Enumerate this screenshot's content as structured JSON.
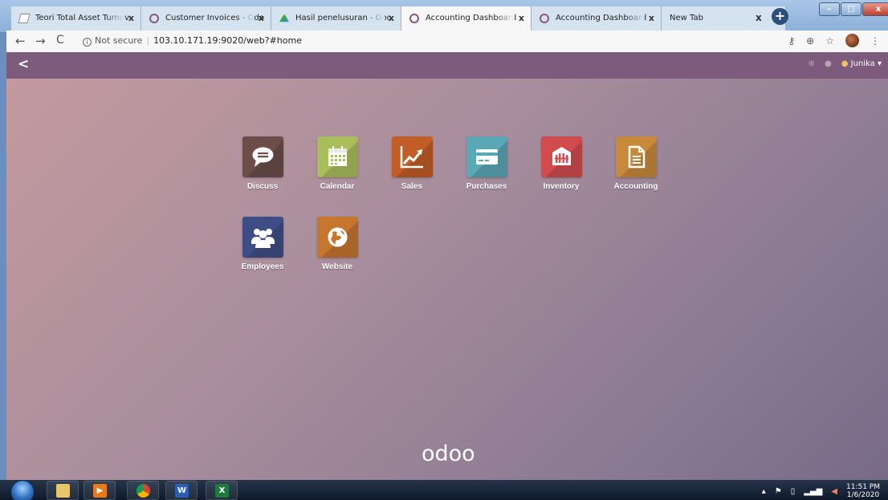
{
  "browser": {
    "tabs": [
      {
        "title": "Teori Total Asset Turnov",
        "favicon": "document-icon",
        "active": false
      },
      {
        "title": "Customer Invoices - Odo",
        "favicon": "odoo-icon",
        "active": false
      },
      {
        "title": "Hasil penelusuran - Goo",
        "favicon": "google-drive-icon",
        "active": false
      },
      {
        "title": "Accounting Dashboard",
        "favicon": "odoo-icon",
        "active": true
      },
      {
        "title": "Accounting Dashboard",
        "favicon": "odoo-icon",
        "active": false
      },
      {
        "title": "New Tab",
        "favicon": "",
        "active": false
      }
    ],
    "tab_close_glyph": "x",
    "new_tab_glyph": "+",
    "security_label": "Not secure",
    "url": "103.10.171.19:9020/web?#home"
  },
  "odoo": {
    "user_name": "Junika",
    "apps": [
      {
        "label": "Discuss",
        "color": "#6b4d4a",
        "icon": "chat-bubble-icon"
      },
      {
        "label": "Calendar",
        "color": "#a9be5a",
        "icon": "calendar-icon"
      },
      {
        "label": "Sales",
        "color": "#c25d27",
        "icon": "chart-line-icon"
      },
      {
        "label": "Purchases",
        "color": "#5aa7b6",
        "icon": "credit-card-icon"
      },
      {
        "label": "Inventory",
        "color": "#d04c4f",
        "icon": "warehouse-icon"
      },
      {
        "label": "Accounting",
        "color": "#c88a3a",
        "icon": "document-icon"
      },
      {
        "label": "Employees",
        "color": "#3f4d86",
        "icon": "users-icon"
      },
      {
        "label": "Website",
        "color": "#c7762e",
        "icon": "globe-icon"
      }
    ],
    "logo_text": "odoo"
  },
  "taskbar": {
    "apps": [
      {
        "name": "file-explorer",
        "glyph": ""
      },
      {
        "name": "media-player",
        "glyph": "▶"
      },
      {
        "name": "chrome",
        "glyph": ""
      },
      {
        "name": "word",
        "glyph": "W"
      },
      {
        "name": "excel",
        "glyph": "X"
      }
    ],
    "time": "11:51 PM",
    "date": "1/6/2020"
  }
}
